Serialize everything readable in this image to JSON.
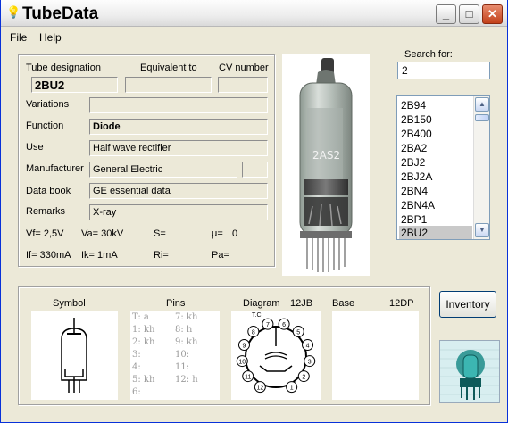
{
  "window": {
    "title": "TubeData"
  },
  "menu": {
    "file": "File",
    "help": "Help"
  },
  "details": {
    "tube_designation_label": "Tube designation",
    "tube_designation": "2BU2",
    "equivalent_label": "Equivalent to",
    "equivalent": "",
    "cv_label": "CV number",
    "cv": "",
    "variations_label": "Variations",
    "variations": "",
    "function_label": "Function",
    "function": "Diode",
    "use_label": "Use",
    "use": "Half wave rectifier",
    "manufacturer_label": "Manufacturer",
    "manufacturer": "General Electric",
    "manufacturer_code": "",
    "databook_label": "Data book",
    "databook": "GE essential data",
    "remarks_label": "Remarks",
    "remarks": "X-ray",
    "params_row1": [
      "Vf= 2,5V",
      "Va= 30kV",
      "S=",
      "μ=",
      "0"
    ],
    "params_row2": [
      "If= 330mA",
      "Ik= 1mA",
      "Ri=",
      "Pa="
    ]
  },
  "search": {
    "label": "Search for:",
    "value": "2",
    "results": [
      "2B94",
      "2B150",
      "2B400",
      "2BA2",
      "2BJ2",
      "2BJ2A",
      "2BN4",
      "2BN4A",
      "2BP1",
      "2BU2"
    ],
    "selected": "2BU2"
  },
  "bottom": {
    "symbol_label": "Symbol",
    "pins_label": "Pins",
    "diagram_label": "Diagram",
    "diagram_code": "12JB",
    "base_label": "Base",
    "base_code": "12DP",
    "pins_col1": [
      "T: a",
      "1: kh",
      "2: kh",
      "3:",
      "4:",
      "5: kh",
      "6:"
    ],
    "pins_col2": [
      "7: kh",
      "8: h",
      "9: kh",
      "10:",
      "11:",
      "12: h"
    ],
    "diagram_pins": [
      "1",
      "2",
      "3",
      "4",
      "5",
      "6",
      "7",
      "8",
      "9",
      "10",
      "11",
      "12"
    ],
    "diagram_tc": "T.C."
  },
  "buttons": {
    "inventory": "Inventory"
  },
  "photo": {
    "marking": "2AS2"
  },
  "icons": {
    "app": "bulb-icon",
    "minimize": "minimize-icon",
    "maximize": "maximize-icon",
    "close": "close-icon"
  },
  "colors": {
    "titlebar": "#EDEDED",
    "close": "#C2401A",
    "selection": "#C9C9C9",
    "panel": "#ECE9D8"
  }
}
